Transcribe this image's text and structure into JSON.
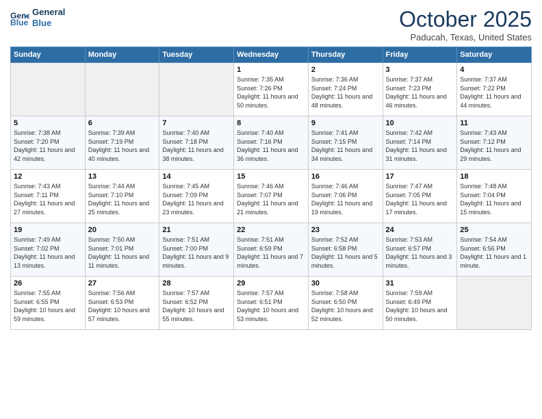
{
  "header": {
    "logo_line1": "General",
    "logo_line2": "Blue",
    "month": "October 2025",
    "location": "Paducah, Texas, United States"
  },
  "days_of_week": [
    "Sunday",
    "Monday",
    "Tuesday",
    "Wednesday",
    "Thursday",
    "Friday",
    "Saturday"
  ],
  "weeks": [
    [
      {
        "day": "",
        "info": ""
      },
      {
        "day": "",
        "info": ""
      },
      {
        "day": "",
        "info": ""
      },
      {
        "day": "1",
        "info": "Sunrise: 7:35 AM\nSunset: 7:26 PM\nDaylight: 11 hours and 50 minutes."
      },
      {
        "day": "2",
        "info": "Sunrise: 7:36 AM\nSunset: 7:24 PM\nDaylight: 11 hours and 48 minutes."
      },
      {
        "day": "3",
        "info": "Sunrise: 7:37 AM\nSunset: 7:23 PM\nDaylight: 11 hours and 46 minutes."
      },
      {
        "day": "4",
        "info": "Sunrise: 7:37 AM\nSunset: 7:22 PM\nDaylight: 11 hours and 44 minutes."
      }
    ],
    [
      {
        "day": "5",
        "info": "Sunrise: 7:38 AM\nSunset: 7:20 PM\nDaylight: 11 hours and 42 minutes."
      },
      {
        "day": "6",
        "info": "Sunrise: 7:39 AM\nSunset: 7:19 PM\nDaylight: 11 hours and 40 minutes."
      },
      {
        "day": "7",
        "info": "Sunrise: 7:40 AM\nSunset: 7:18 PM\nDaylight: 11 hours and 38 minutes."
      },
      {
        "day": "8",
        "info": "Sunrise: 7:40 AM\nSunset: 7:16 PM\nDaylight: 11 hours and 36 minutes."
      },
      {
        "day": "9",
        "info": "Sunrise: 7:41 AM\nSunset: 7:15 PM\nDaylight: 11 hours and 34 minutes."
      },
      {
        "day": "10",
        "info": "Sunrise: 7:42 AM\nSunset: 7:14 PM\nDaylight: 11 hours and 31 minutes."
      },
      {
        "day": "11",
        "info": "Sunrise: 7:43 AM\nSunset: 7:12 PM\nDaylight: 11 hours and 29 minutes."
      }
    ],
    [
      {
        "day": "12",
        "info": "Sunrise: 7:43 AM\nSunset: 7:11 PM\nDaylight: 11 hours and 27 minutes."
      },
      {
        "day": "13",
        "info": "Sunrise: 7:44 AM\nSunset: 7:10 PM\nDaylight: 11 hours and 25 minutes."
      },
      {
        "day": "14",
        "info": "Sunrise: 7:45 AM\nSunset: 7:09 PM\nDaylight: 11 hours and 23 minutes."
      },
      {
        "day": "15",
        "info": "Sunrise: 7:46 AM\nSunset: 7:07 PM\nDaylight: 11 hours and 21 minutes."
      },
      {
        "day": "16",
        "info": "Sunrise: 7:46 AM\nSunset: 7:06 PM\nDaylight: 11 hours and 19 minutes."
      },
      {
        "day": "17",
        "info": "Sunrise: 7:47 AM\nSunset: 7:05 PM\nDaylight: 11 hours and 17 minutes."
      },
      {
        "day": "18",
        "info": "Sunrise: 7:48 AM\nSunset: 7:04 PM\nDaylight: 11 hours and 15 minutes."
      }
    ],
    [
      {
        "day": "19",
        "info": "Sunrise: 7:49 AM\nSunset: 7:02 PM\nDaylight: 11 hours and 13 minutes."
      },
      {
        "day": "20",
        "info": "Sunrise: 7:50 AM\nSunset: 7:01 PM\nDaylight: 11 hours and 11 minutes."
      },
      {
        "day": "21",
        "info": "Sunrise: 7:51 AM\nSunset: 7:00 PM\nDaylight: 11 hours and 9 minutes."
      },
      {
        "day": "22",
        "info": "Sunrise: 7:51 AM\nSunset: 6:59 PM\nDaylight: 11 hours and 7 minutes."
      },
      {
        "day": "23",
        "info": "Sunrise: 7:52 AM\nSunset: 6:58 PM\nDaylight: 11 hours and 5 minutes."
      },
      {
        "day": "24",
        "info": "Sunrise: 7:53 AM\nSunset: 6:57 PM\nDaylight: 11 hours and 3 minutes."
      },
      {
        "day": "25",
        "info": "Sunrise: 7:54 AM\nSunset: 6:56 PM\nDaylight: 11 hours and 1 minute."
      }
    ],
    [
      {
        "day": "26",
        "info": "Sunrise: 7:55 AM\nSunset: 6:55 PM\nDaylight: 10 hours and 59 minutes."
      },
      {
        "day": "27",
        "info": "Sunrise: 7:56 AM\nSunset: 6:53 PM\nDaylight: 10 hours and 57 minutes."
      },
      {
        "day": "28",
        "info": "Sunrise: 7:57 AM\nSunset: 6:52 PM\nDaylight: 10 hours and 55 minutes."
      },
      {
        "day": "29",
        "info": "Sunrise: 7:57 AM\nSunset: 6:51 PM\nDaylight: 10 hours and 53 minutes."
      },
      {
        "day": "30",
        "info": "Sunrise: 7:58 AM\nSunset: 6:50 PM\nDaylight: 10 hours and 52 minutes."
      },
      {
        "day": "31",
        "info": "Sunrise: 7:59 AM\nSunset: 6:49 PM\nDaylight: 10 hours and 50 minutes."
      },
      {
        "day": "",
        "info": ""
      }
    ]
  ]
}
